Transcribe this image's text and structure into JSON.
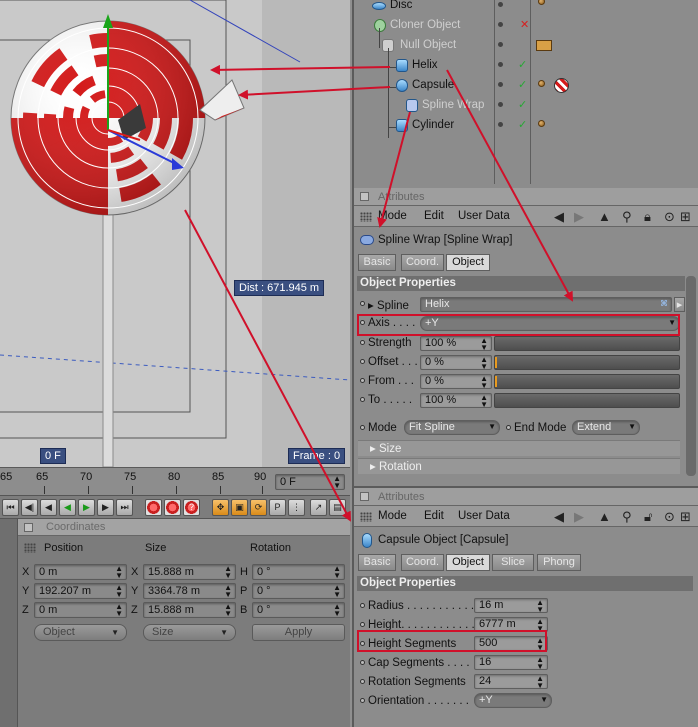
{
  "viewport": {
    "dist_label": "Dist : 671.945 m",
    "frame_left": "0 F",
    "frame_right": "Frame : 0"
  },
  "timeline": {
    "ticks": [
      "65",
      "70",
      "75",
      "80",
      "85",
      "90"
    ],
    "current_frame": "0 F"
  },
  "coordinates": {
    "title": "Coordinates",
    "col_position": "Position",
    "col_size": "Size",
    "col_rotation": "Rotation",
    "rows": [
      {
        "pos_axis": "X",
        "pos": "0 m",
        "size_axis": "X",
        "size": "15.888 m",
        "rot_axis": "H",
        "rot": "0 °"
      },
      {
        "pos_axis": "Y",
        "pos": "192.207 m",
        "size_axis": "Y",
        "size": "3364.78 m",
        "rot_axis": "P",
        "rot": "0 °"
      },
      {
        "pos_axis": "Z",
        "pos": "0 m",
        "size_axis": "Z",
        "size": "15.888 m",
        "rot_axis": "B",
        "rot": "0 °"
      }
    ],
    "mode_select": "Object",
    "size_select": "Size",
    "apply_label": "Apply"
  },
  "objects": [
    {
      "name": "Disc",
      "dim": false
    },
    {
      "name": "Cloner Object",
      "dim": true
    },
    {
      "name": "Null Object",
      "dim": true
    },
    {
      "name": "Helix",
      "dim": false
    },
    {
      "name": "Capsule",
      "dim": false
    },
    {
      "name": "Spline Wrap",
      "dim": true
    },
    {
      "name": "Cylinder",
      "dim": false
    }
  ],
  "attributes1": {
    "panel_title": "Attributes",
    "menu": [
      "Mode",
      "Edit",
      "User Data"
    ],
    "object_title": "Spline Wrap [Spline Wrap]",
    "tabs": [
      "Basic",
      "Coord.",
      "Object"
    ],
    "active_tab": "Object",
    "section": "Object Properties",
    "props": {
      "spline_label": "Spline",
      "spline_value": "Helix",
      "axis_label": "Axis . . . .",
      "axis_value": "+Y",
      "strength_label": "Strength",
      "strength_value": "100 %",
      "offset_label": "Offset . . .",
      "offset_value": "0 %",
      "from_label": "From . . .",
      "from_value": "0 %",
      "to_label": "To . . . . .",
      "to_value": "100 %",
      "mode_label": "Mode",
      "mode_value": "Fit Spline",
      "endmode_label": "End Mode",
      "endmode_value": "Extend"
    },
    "collapsed": [
      "Size",
      "Rotation"
    ]
  },
  "attributes2": {
    "panel_title": "Attributes",
    "menu": [
      "Mode",
      "Edit",
      "User Data"
    ],
    "object_title": "Capsule Object [Capsule]",
    "tabs": [
      "Basic",
      "Coord.",
      "Object",
      "Slice",
      "Phong"
    ],
    "active_tab": "Object",
    "section": "Object Properties",
    "props": [
      {
        "label": "Radius . . . . . . . . . . .",
        "value": "16 m"
      },
      {
        "label": "Height. . . . . . . . . . . .",
        "value": "6777 m"
      },
      {
        "label": "Height Segments",
        "value": "500"
      },
      {
        "label": "Cap Segments . . . .",
        "value": "16"
      },
      {
        "label": "Rotation Segments",
        "value": "24"
      },
      {
        "label": "Orientation . . . . . . .",
        "value": "+Y"
      }
    ]
  },
  "colors": {
    "annotation_red": "#d0102a",
    "candy_red": "#d41a1a",
    "viewport_bg": "#c9c9c9"
  }
}
